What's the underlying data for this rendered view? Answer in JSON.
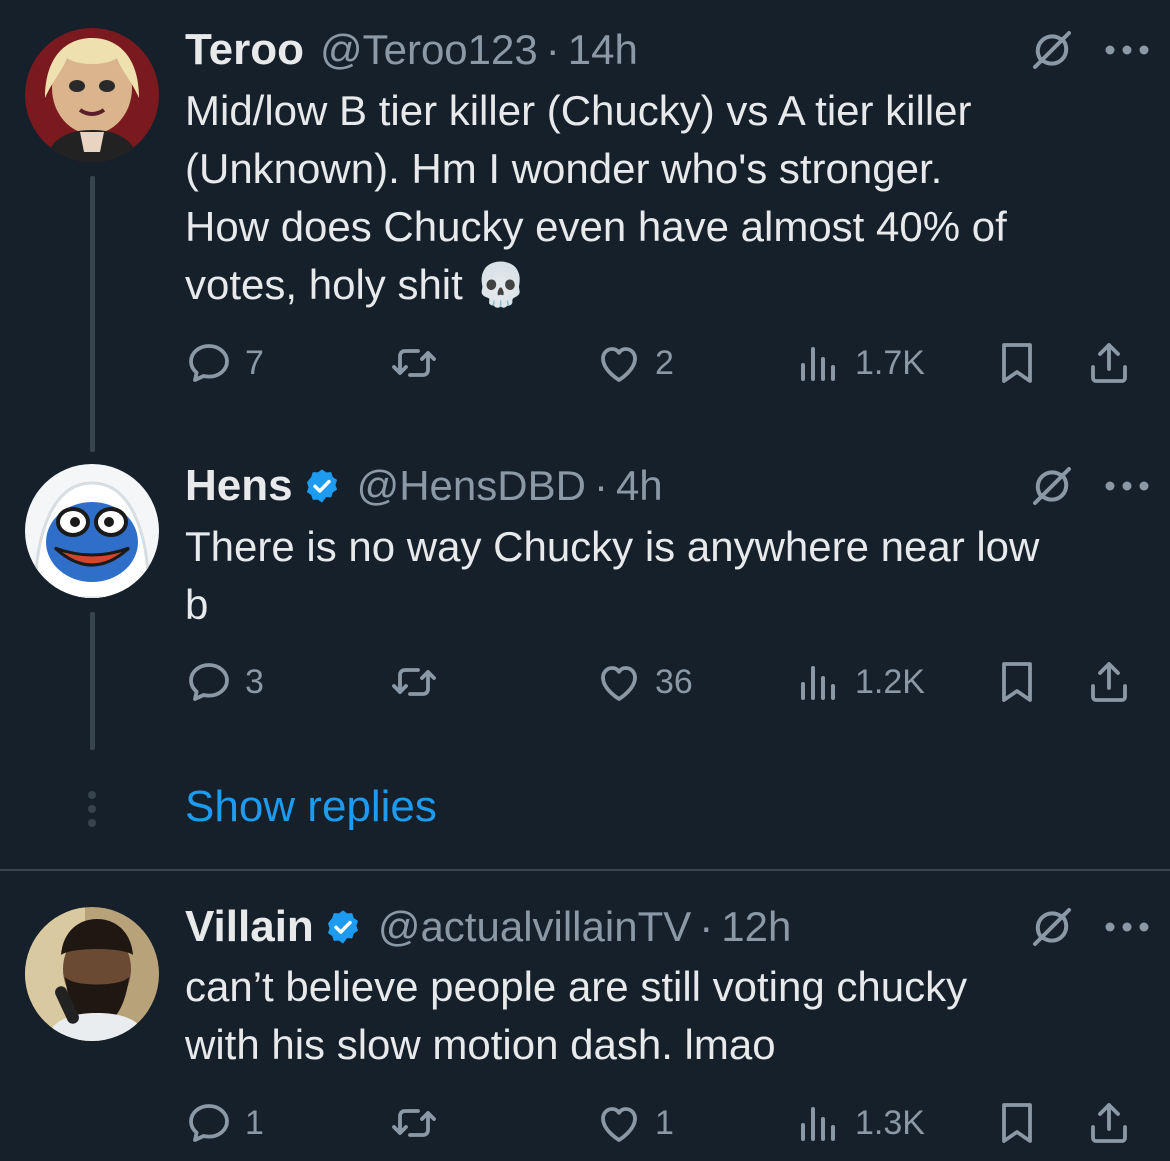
{
  "tweets": [
    {
      "name": "Teroo",
      "handle": "@Teroo123",
      "separator": "·",
      "time": "14h",
      "verified": false,
      "text_lines": [
        "Mid/low B tier killer (Chucky) vs A tier killer",
        "(Unknown). Hm I wonder who's stronger.",
        "How does Chucky even have almost 40% of",
        "votes, holy shit 💀"
      ],
      "replies": "7",
      "retweets": "",
      "likes": "2",
      "views": "1.7K"
    },
    {
      "name": "Hens",
      "handle": "@HensDBD",
      "separator": "·",
      "time": "4h",
      "verified": true,
      "text_lines": [
        "There is no way Chucky is anywhere near low",
        "b"
      ],
      "replies": "3",
      "retweets": "",
      "likes": "36",
      "views": "1.2K"
    },
    {
      "name": "Villain",
      "handle": "@actualvillainTV",
      "separator": "·",
      "time": "12h",
      "verified": true,
      "text_lines": [
        "can’t believe people are still voting chucky",
        "with his slow motion dash. lmao"
      ],
      "replies": "1",
      "retweets": "",
      "likes": "1",
      "views": "1.3K"
    }
  ],
  "show_replies_label": "Show replies",
  "colors": {
    "background": "#15202b",
    "text": "#e7e9ea",
    "secondary": "#8b98a5",
    "accent": "#1d9bf0",
    "divider": "#38444d"
  },
  "icons": [
    "reply-icon",
    "retweet-icon",
    "like-icon",
    "views-icon",
    "bookmark-icon",
    "share-icon",
    "grok-icon",
    "more-icon",
    "verified-badge-icon"
  ]
}
